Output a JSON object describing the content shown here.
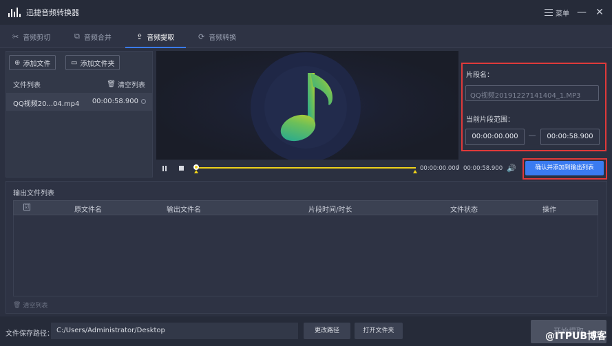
{
  "app": {
    "title": "迅捷音频转换器",
    "menu_label": "菜单",
    "minimize_glyph": "—",
    "close_glyph": "✕"
  },
  "tabs": [
    {
      "label": "音频剪切",
      "icon": "scissors-icon",
      "active": false
    },
    {
      "label": "音频合并",
      "icon": "merge-icon",
      "active": false
    },
    {
      "label": "音频提取",
      "icon": "extract-icon",
      "active": true
    },
    {
      "label": "音频转换",
      "icon": "convert-icon",
      "active": false
    }
  ],
  "left_panel": {
    "add_file": "添加文件",
    "add_folder": "添加文件夹",
    "list_label": "文件列表",
    "clear_list": "清空列表",
    "files": [
      {
        "name": "QQ视频20...04.mp4",
        "duration": "00:00:58.900"
      }
    ]
  },
  "segment": {
    "name_label": "片段名：",
    "name_value": "QQ视频20191227141404_1.MP3",
    "range_label": "当前片段范围：",
    "start": "00:00:00.000",
    "end": "00:00:58.900",
    "confirm_button": "确认并添加到输出列表"
  },
  "player": {
    "current_time": "00:00:00.000",
    "separator": "/",
    "total_time": "00:00:58.900",
    "progress": 0.0
  },
  "output": {
    "title": "输出文件列表",
    "columns": [
      "原文件名",
      "输出文件名",
      "片段时间/时长",
      "文件状态",
      "操作"
    ],
    "rows": [],
    "clear_list": "清空列表"
  },
  "footer": {
    "path_label": "文件保存路径：",
    "path_value": "C:/Users/Administrator/Desktop",
    "change_path": "更改路径",
    "open_folder": "打开文件夹",
    "start_button": "开始提取"
  },
  "watermark": "@ITPUB博客",
  "colors": {
    "accent": "#3a7bf0",
    "highlight_red": "#e03a3a",
    "track_yellow": "#f0d31a",
    "background": "#2b3040"
  }
}
